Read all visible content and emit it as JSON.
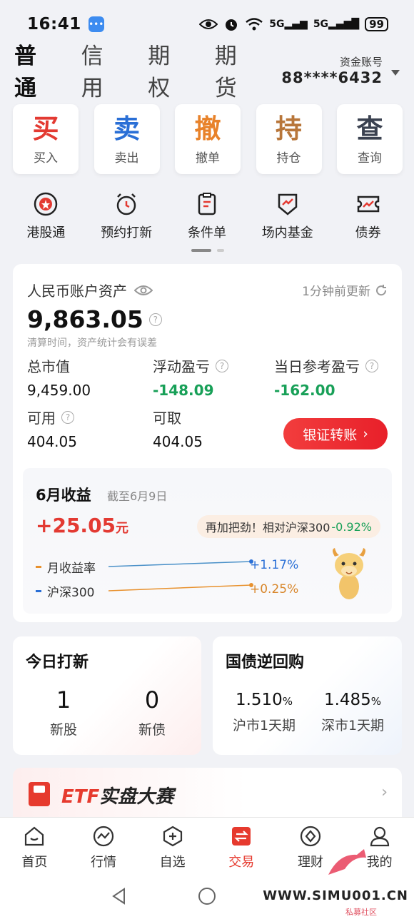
{
  "status_bar": {
    "time": "16:41",
    "signal1": "5G",
    "signal2": "5G",
    "battery": "99"
  },
  "header": {
    "tabs": [
      "普通",
      "信用",
      "期权",
      "期货"
    ],
    "active_tab": "普通",
    "account_label": "资金账号",
    "account_number": "88****6432"
  },
  "actions": [
    {
      "char": "买",
      "label": "买入",
      "color": "#e33a32"
    },
    {
      "char": "卖",
      "label": "卖出",
      "color": "#2a6fd6"
    },
    {
      "char": "撤",
      "label": "撤单",
      "color": "#e8822a"
    },
    {
      "char": "持",
      "label": "持仓",
      "color": "#b8763a"
    },
    {
      "char": "查",
      "label": "查询",
      "color": "#3a4150"
    }
  ],
  "shortcuts": [
    {
      "icon": "hk-stock-icon",
      "label": "港股通"
    },
    {
      "icon": "alarm-clock-icon",
      "label": "预约打新"
    },
    {
      "icon": "clipboard-icon",
      "label": "条件单"
    },
    {
      "icon": "fund-shield-icon",
      "label": "场内基金"
    },
    {
      "icon": "bond-ticket-icon",
      "label": "债券"
    }
  ],
  "asset": {
    "title": "人民币账户资产",
    "updated": "1分钟前更新",
    "total": "9,863.05",
    "note": "清算时间，资产统计会有误差",
    "market_value_label": "总市值",
    "market_value": "9,459.00",
    "floating_pl_label": "浮动盈亏",
    "floating_pl": "-148.09",
    "daily_pl_label": "当日参考盈亏",
    "daily_pl": "-162.00",
    "available_label": "可用",
    "available": "404.05",
    "withdrawable_label": "可取",
    "withdrawable": "404.05",
    "transfer_button": "银证转账"
  },
  "monthly": {
    "title": "6月收益",
    "as_of": "截至6月9日",
    "gain": "+25.05",
    "unit": "元",
    "bubble_text": "再加把劲！相对沪深300",
    "bubble_value": "-0.92%",
    "legend": [
      {
        "label": "月收益率",
        "value": "+1.17%",
        "color": "#e8912e",
        "value_color": "#2a6fd6"
      },
      {
        "label": "沪深300",
        "value": "+0.25%",
        "color": "#2a6fd6",
        "value_color": "#d8862a"
      }
    ]
  },
  "ipo": {
    "title": "今日打新",
    "stocks_count": "1",
    "stocks_label": "新股",
    "bonds_count": "0",
    "bonds_label": "新债"
  },
  "repo": {
    "title": "国债逆回购",
    "sh_rate": "1.510",
    "sh_label": "沪市1天期",
    "sz_rate": "1.485",
    "sz_label": "深市1天期",
    "pct": "%"
  },
  "banner": {
    "etf": "ETF",
    "text": "实盘大赛"
  },
  "bottom_nav": [
    {
      "icon": "home-icon",
      "label": "首页"
    },
    {
      "icon": "market-icon",
      "label": "行情"
    },
    {
      "icon": "watchlist-icon",
      "label": "自选"
    },
    {
      "icon": "trade-icon",
      "label": "交易",
      "active": true
    },
    {
      "icon": "wealth-icon",
      "label": "理财"
    },
    {
      "icon": "profile-icon",
      "label": "我的"
    }
  ],
  "watermark": {
    "site": "WWW.SIMU001.CN",
    "sub": "私募社区"
  }
}
